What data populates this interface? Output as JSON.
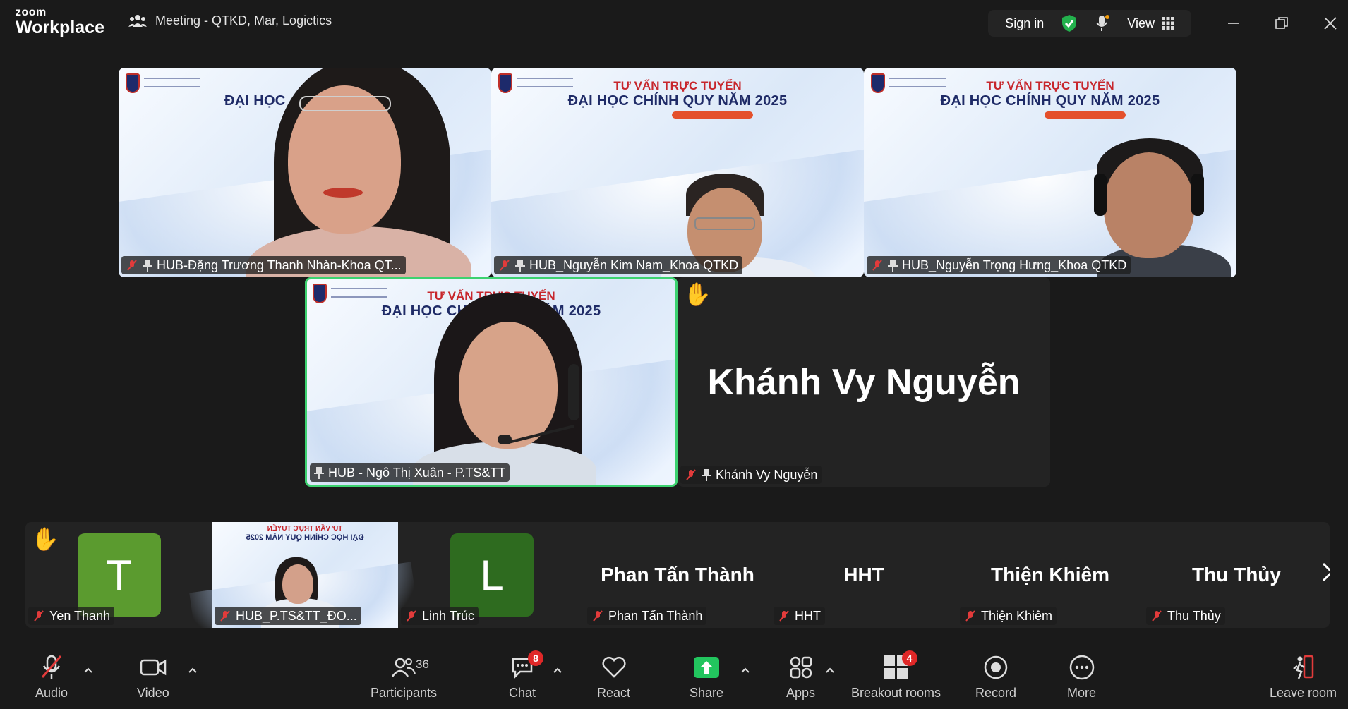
{
  "app": {
    "logo_top": "zoom",
    "logo_bottom": "Workplace"
  },
  "meeting": {
    "title": "Meeting - QTKD, Mar, Logictics"
  },
  "titlebar": {
    "sign_in": "Sign in",
    "view": "View"
  },
  "slide": {
    "line1": "TƯ VẤN TRỰC TUYẾN",
    "line2": "ĐẠI HỌC CHÍNH QUY NĂM 2025"
  },
  "video_tiles": [
    {
      "name": "HUB-Đặng Trương Thanh Nhàn-Khoa QT..."
    },
    {
      "name": "HUB_Nguyễn Kim Nam_Khoa QTKD"
    },
    {
      "name": "HUB_Nguyễn Trọng Hưng_Khoa QTKD"
    },
    {
      "name": "HUB - Ngô Thị Xuân - P.TS&TT"
    },
    {
      "name": "Khánh Vy Nguyễn",
      "display": "Khánh Vy Nguyễn"
    }
  ],
  "filmstrip": [
    {
      "name": "Yen Thanh",
      "initial": "T",
      "color": "#5b9b2f"
    },
    {
      "name": "HUB_P.TS&TT_ĐO...",
      "mirrored_line1": "TƯ VẤN TRỰC TUYẾN",
      "mirrored_line2": "ĐẠI HỌC CHÍNH QUY NĂM 2025"
    },
    {
      "name": "Linh Trúc",
      "initial": "L",
      "color": "#2e6b1f"
    },
    {
      "name": "Phan Tấn Thành",
      "display": "Phan Tấn Thành"
    },
    {
      "name": "HHT",
      "display": "HHT"
    },
    {
      "name": "Thiện Khiêm",
      "display": "Thiện Khiêm"
    },
    {
      "name": "Thu Thủy",
      "display": "Thu Thủy"
    }
  ],
  "toolbar": {
    "audio": "Audio",
    "video": "Video",
    "participants": "Participants",
    "participants_count": "36",
    "chat": "Chat",
    "chat_badge": "8",
    "react": "React",
    "share": "Share",
    "apps": "Apps",
    "breakout": "Breakout rooms",
    "breakout_badge": "4",
    "record": "Record",
    "more": "More",
    "leave": "Leave room"
  },
  "colors": {
    "active_border": "#3cd270",
    "badge": "#e02828",
    "share": "#22c55e",
    "muted": "#e23b3b"
  }
}
